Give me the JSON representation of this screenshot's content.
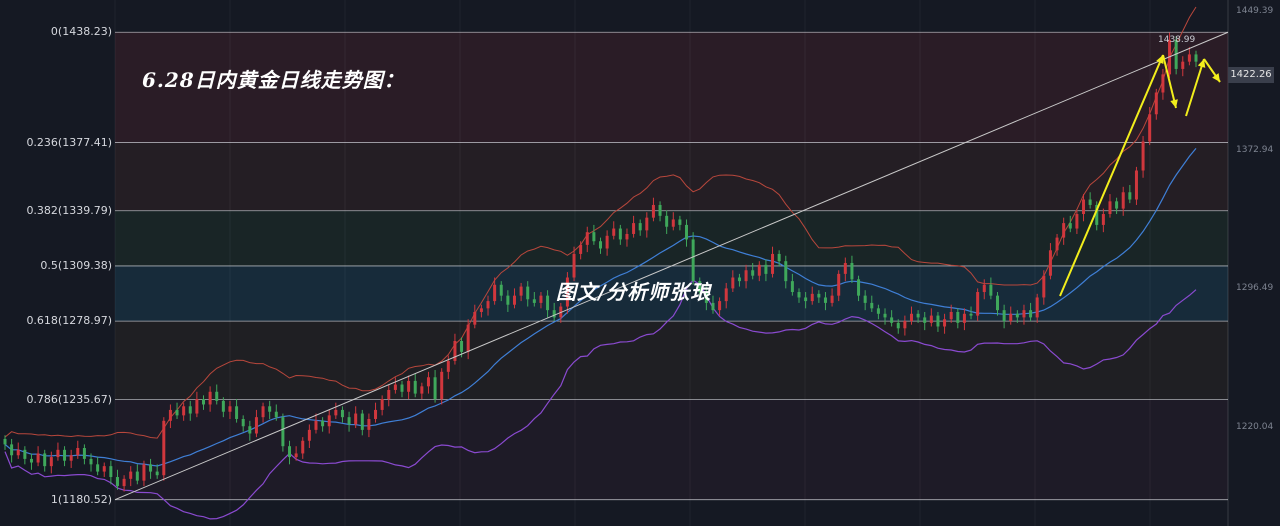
{
  "title": "6.28日内黄金日线走势图：",
  "watermark": "图文/分析师张琅",
  "peak_label": "1438.99",
  "current_price": "1422.26",
  "colors": {
    "background": "#151923",
    "up_candle": "#d0373d",
    "down_candle": "#3fa85b",
    "ma_line": "#3f7fd6",
    "upper_band": "#b8473c",
    "lower_band": "#8a4ad0",
    "arrow": "#f2ee1c",
    "trendline": "#c9c9c9"
  },
  "chart_data": {
    "type": "candlestick",
    "title": "6.28日内黄金日线走势图：",
    "fibonacci_levels": [
      {
        "label": "0(1438.23)",
        "ratio": 0,
        "price": 1438.23
      },
      {
        "label": "0.236(1377.41)",
        "ratio": 0.236,
        "price": 1377.41
      },
      {
        "label": "0.382(1339.79)",
        "ratio": 0.382,
        "price": 1339.79
      },
      {
        "label": "0.5(1309.38)",
        "ratio": 0.5,
        "price": 1309.38
      },
      {
        "label": "0.618(1278.97)",
        "ratio": 0.618,
        "price": 1278.97
      },
      {
        "label": "0.786(1235.67)",
        "ratio": 0.786,
        "price": 1235.67
      },
      {
        "label": "1(1180.52)",
        "ratio": 1,
        "price": 1180.52
      }
    ],
    "price_axis_ticks": [
      "1449.39",
      "1372.94",
      "1296.49",
      "1220.04"
    ],
    "price_axis_values": [
      1449.39,
      1372.94,
      1296.49,
      1220.04
    ],
    "ylim": [
      1166,
      1456
    ],
    "peak": 1438.99,
    "last_price": 1422.26,
    "closes": [
      1211,
      1205,
      1208,
      1203,
      1201,
      1206,
      1199,
      1204,
      1208,
      1202,
      1205,
      1209,
      1203,
      1200,
      1196,
      1199,
      1193,
      1188,
      1192,
      1196,
      1191,
      1200,
      1196,
      1194,
      1224,
      1230,
      1227,
      1232,
      1228,
      1236,
      1233,
      1240,
      1235,
      1229,
      1232,
      1225,
      1221,
      1217,
      1226,
      1232,
      1229,
      1226,
      1210,
      1204,
      1206,
      1213,
      1219,
      1224,
      1221,
      1227,
      1230,
      1226,
      1222,
      1228,
      1219,
      1225,
      1230,
      1236,
      1241,
      1244,
      1240,
      1246,
      1239,
      1243,
      1248,
      1236,
      1251,
      1257,
      1268,
      1262,
      1277,
      1284,
      1286,
      1290,
      1299,
      1293,
      1288,
      1293,
      1298,
      1291,
      1289,
      1293,
      1285,
      1281,
      1287,
      1303,
      1316,
      1321,
      1328,
      1323,
      1319,
      1326,
      1330,
      1324,
      1327,
      1333,
      1329,
      1336,
      1343,
      1337,
      1331,
      1335,
      1332,
      1324,
      1301,
      1295,
      1289,
      1285,
      1290,
      1297,
      1303,
      1301,
      1307,
      1304,
      1310,
      1305,
      1316,
      1312,
      1301,
      1295,
      1292,
      1290,
      1294,
      1292,
      1289,
      1293,
      1305,
      1311,
      1302,
      1293,
      1289,
      1286,
      1283,
      1281,
      1278,
      1275,
      1279,
      1283,
      1281,
      1278,
      1282,
      1276,
      1280,
      1284,
      1278,
      1283,
      1282,
      1295,
      1299,
      1293,
      1285,
      1279,
      1283,
      1281,
      1285,
      1281,
      1292,
      1304,
      1318,
      1325,
      1333,
      1330,
      1338,
      1346,
      1343,
      1332,
      1338,
      1345,
      1341,
      1350,
      1346,
      1362,
      1378,
      1393,
      1405,
      1415,
      1434,
      1418,
      1422,
      1426,
      1422
    ],
    "trendline_from_price": 1180.52,
    "trendline_to_price": 1438.23
  }
}
